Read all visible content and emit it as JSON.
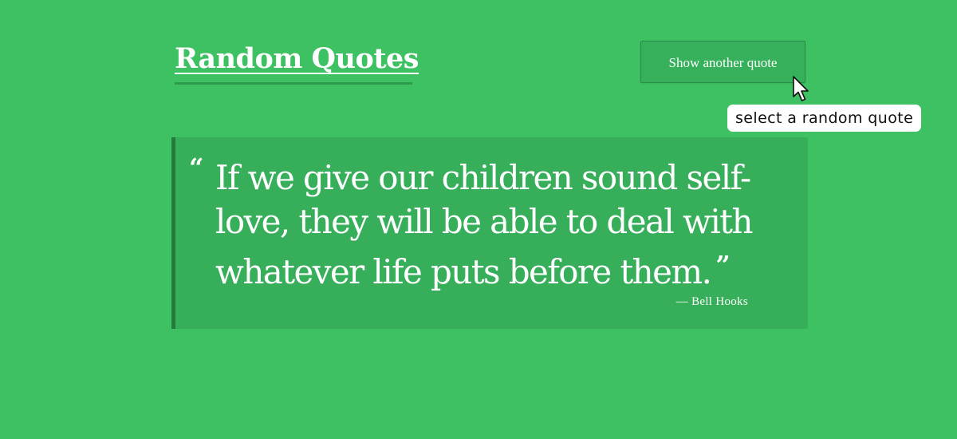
{
  "header": {
    "title": "Random Quotes"
  },
  "actions": {
    "new_quote_label": "Show another quote",
    "tooltip": "select a random quote"
  },
  "quote": {
    "open_mark": "“",
    "text": "If we give our children sound self-love, they will be able to deal with whatever life puts before them.",
    "close_mark": "”",
    "author": "— Bell Hooks"
  },
  "colors": {
    "background": "#3ec162",
    "card": "#36ae5a",
    "card_border": "#247a3c",
    "text": "#ffffff"
  },
  "icons": {
    "cursor": "mouse-pointer-icon"
  }
}
